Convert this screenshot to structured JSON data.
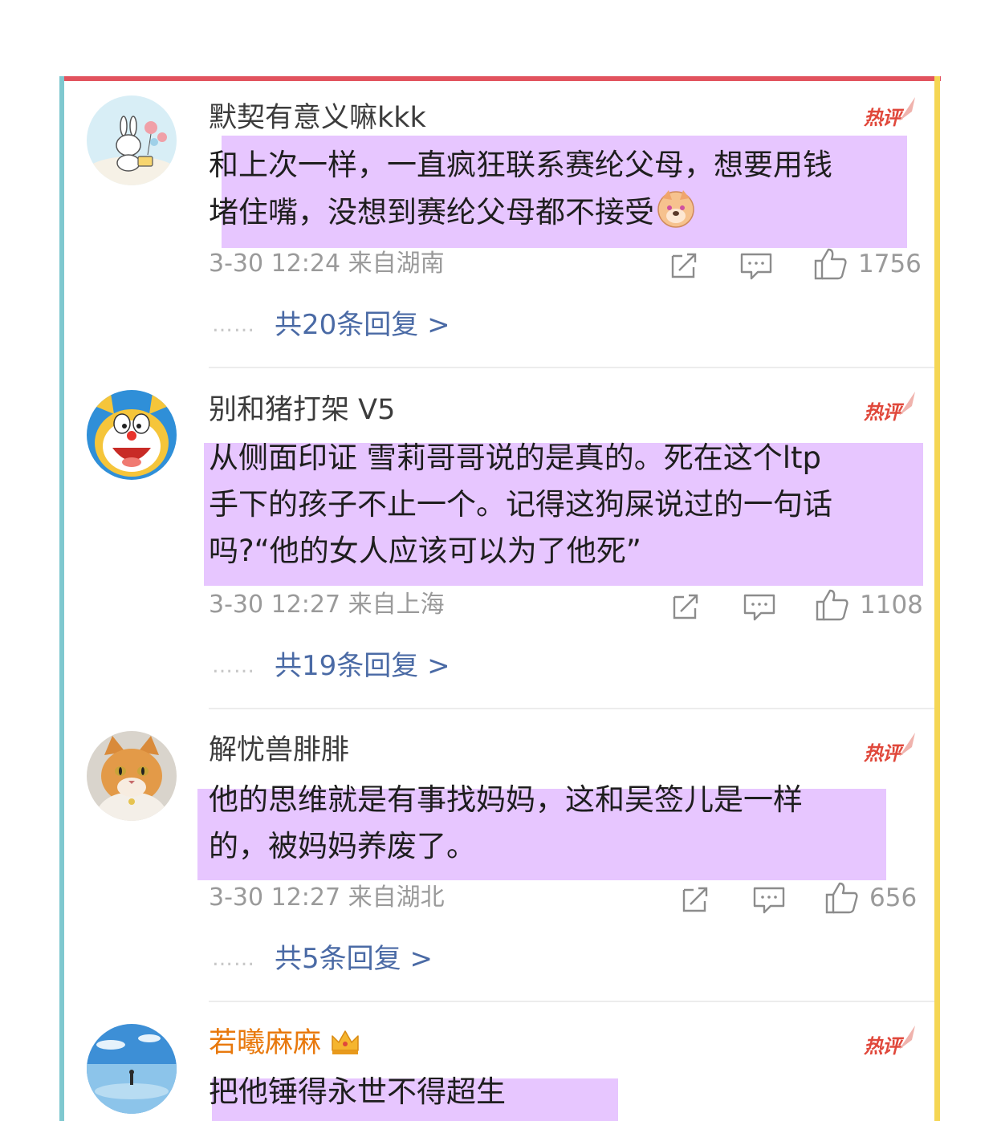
{
  "hot_badge": "热评",
  "comments": [
    {
      "user": "默契有意义嘛kkk",
      "avatar": "bunny-cake-avatar",
      "lines": [
        "和上次一样，一直疯狂联系赛纶父母，想要用钱",
        "堵住嘴，没想到赛纶父母都不接受"
      ],
      "emoji": "doge-face",
      "meta": "3-30 12:24  来自湖南",
      "likes": "1756",
      "replies": "共20条回复 >"
    },
    {
      "user": "别和猪打架 V5",
      "avatar": "doraemon-avatar",
      "lines": [
        "从侧面印证 雪莉哥哥说的是真的。死在这个ltp",
        "手下的孩子不止一个。记得这狗屎说过的一句话",
        "吗?“他的女人应该可以为了他死”"
      ],
      "meta": "3-30 12:27  来自上海",
      "likes": "1108",
      "replies": "共19条回复 >"
    },
    {
      "user": "解忧兽腓腓",
      "avatar": "orange-cat-avatar",
      "lines": [
        "他的思维就是有事找妈妈，这和吴签儿是一样",
        "的，被妈妈养废了。"
      ],
      "meta": "3-30 12:27  来自湖北",
      "likes": "656",
      "replies": "共5条回复 >"
    },
    {
      "user": "若曦麻麻",
      "avatar": "beach-sky-avatar",
      "badge": "crown-icon",
      "lines": [
        "把他锤得永世不得超生"
      ]
    }
  ],
  "icons": {
    "share": "share-icon",
    "comment": "comment-icon",
    "like": "thumbs-up-icon"
  },
  "colors": {
    "highlight": "#e7c6ff",
    "frame_top": "#e2535e",
    "frame_left": "#7fc8cf",
    "frame_right": "#f5d654",
    "hot_badge": "#e0483b",
    "link": "#4a6aa5",
    "vip_name": "#e8790d"
  }
}
